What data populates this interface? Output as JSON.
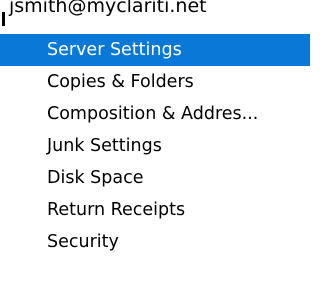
{
  "account": {
    "label": "jsmith@myclariti.net"
  },
  "items": [
    {
      "label": "Server Settings",
      "selected": true
    },
    {
      "label": "Copies & Folders",
      "selected": false
    },
    {
      "label": "Composition & Addres...",
      "selected": false
    },
    {
      "label": "Junk Settings",
      "selected": false
    },
    {
      "label": "Disk Space",
      "selected": false
    },
    {
      "label": "Return Receipts",
      "selected": false
    },
    {
      "label": "Security",
      "selected": false
    }
  ],
  "colors": {
    "selection_background": "#0a78d7",
    "selection_text": "#ffffff"
  }
}
